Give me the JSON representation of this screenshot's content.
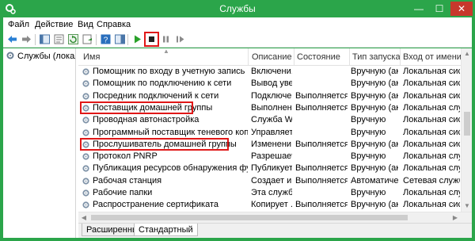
{
  "window": {
    "title": "Службы"
  },
  "controls": {
    "minimize": "—",
    "maximize": "☐",
    "close": "✕"
  },
  "menu": [
    "Файл",
    "Действие",
    "Вид",
    "Справка"
  ],
  "colors": {
    "accent": "#2ba54a",
    "highlight": "#e01818",
    "close": "#c7382c"
  },
  "toolbar_icons": [
    "back-arrow-icon",
    "forward-arrow-icon",
    "console-tree-icon",
    "properties-icon",
    "refresh-icon",
    "export-list-icon",
    "help-icon",
    "properties-panel-icon",
    "start-service-icon",
    "stop-service-icon",
    "pause-service-icon",
    "restart-service-icon"
  ],
  "tree": {
    "label": "Службы (локальн"
  },
  "columns": {
    "name": "Имя",
    "desc": "Описание",
    "state": "Состояние",
    "start": "Тип запуска",
    "logon": "Вход от имени"
  },
  "rows": [
    {
      "name": "Помощник по входу в учетную запись Майкро...",
      "desc": "Включени...",
      "state": "",
      "start": "Вручную (ак...",
      "logon": "Локальная сис...",
      "highlight": false
    },
    {
      "name": "Помощник по подключению к сети",
      "desc": "Вывод уве...",
      "state": "",
      "start": "Вручную (ак...",
      "logon": "Локальная сис...",
      "highlight": false
    },
    {
      "name": "Посредник подключений к сети",
      "desc": "Подключен...",
      "state": "Выполняется",
      "start": "Вручную (ак...",
      "logon": "Локальная сис...",
      "highlight": false
    },
    {
      "name": "Поставщик домашней группы",
      "desc": "Выполнени...",
      "state": "Выполняется",
      "start": "Вручную (ак...",
      "logon": "Локальная слу...",
      "highlight": true
    },
    {
      "name": "Проводная автонастройка",
      "desc": "Служба W...",
      "state": "",
      "start": "Вручную",
      "logon": "Локальная сис...",
      "highlight": false
    },
    {
      "name": "Программный поставщик теневого копирован...",
      "desc": "Управляет...",
      "state": "",
      "start": "Вручную",
      "logon": "Локальная сис...",
      "highlight": false
    },
    {
      "name": "Прослушиватель домашней группы",
      "desc": "Изменени...",
      "state": "Выполняется",
      "start": "Вручную (ак...",
      "logon": "Локальная сис...",
      "highlight": true
    },
    {
      "name": "Протокол PNRP",
      "desc": "Разрешает...",
      "state": "",
      "start": "Вручную",
      "logon": "Локальная слу...",
      "highlight": false
    },
    {
      "name": "Публикация ресурсов обнаружения функции",
      "desc": "Публикует...",
      "state": "Выполняется",
      "start": "Вручную (ак...",
      "logon": "Локальная слу...",
      "highlight": false
    },
    {
      "name": "Рабочая станция",
      "desc": "Создает и ...",
      "state": "Выполняется",
      "start": "Автоматиче...",
      "logon": "Сетевая служба",
      "highlight": false
    },
    {
      "name": "Рабочие папки",
      "desc": "Эта служб...",
      "state": "",
      "start": "Вручную",
      "logon": "Локальная слу...",
      "highlight": false
    },
    {
      "name": "Распространение сертификата",
      "desc": "Копирует ...",
      "state": "Выполняется",
      "start": "Вручную (ак...",
      "logon": "Локальная сис...",
      "highlight": false
    }
  ],
  "tabs": {
    "extended": "Расширенный",
    "standard": "Стандартный"
  }
}
